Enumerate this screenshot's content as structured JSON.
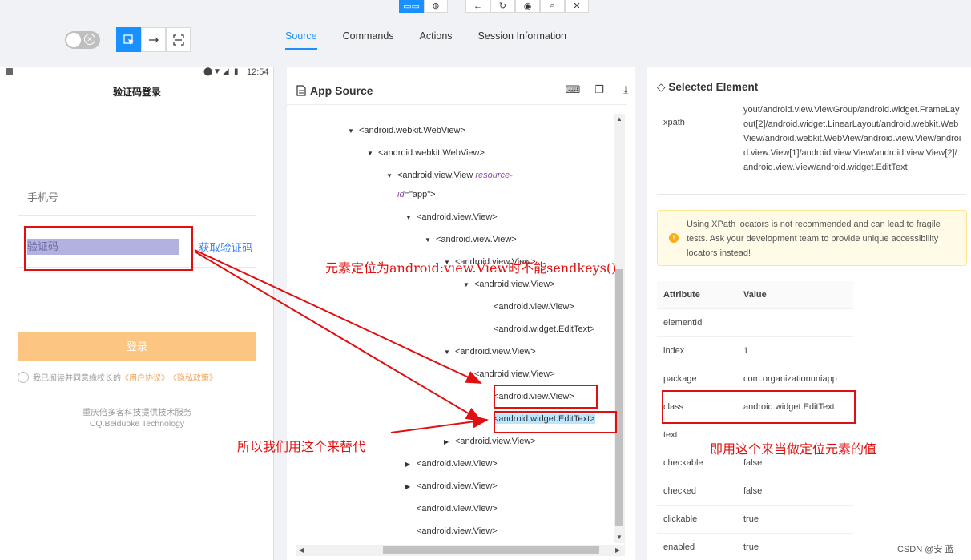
{
  "toolbar": {
    "top_buttons": [
      "▭▭",
      "⊕",
      "←",
      "↻",
      "◉",
      "⌕",
      "✕"
    ],
    "tabs": [
      {
        "label": "Source",
        "active": true
      },
      {
        "label": "Commands",
        "active": false
      },
      {
        "label": "Actions",
        "active": false
      },
      {
        "label": "Session Information",
        "active": false
      }
    ]
  },
  "phone": {
    "time": "12:54",
    "title": "验证码登录",
    "phone_placeholder": "手机号",
    "code_placeholder": "验证码",
    "get_code": "获取验证码",
    "login": "登录",
    "agree_text": "我已阅读并同意缘校长的",
    "agree_link1": "《用户协议》",
    "agree_link2": "《隐私政策》",
    "company_line1": "重庆倍多客科技提供技术服务",
    "company_line2": "CQ.Beiduoke Technology"
  },
  "source": {
    "title": "App Source",
    "icons": [
      "terminal-icon",
      "copy-icon",
      "download-icon"
    ],
    "nodes": [
      {
        "indent": 0,
        "arrow": "▼",
        "tag": "<android.webkit.WebView>"
      },
      {
        "indent": 1,
        "arrow": "▼",
        "tag": "<android.webkit.WebView>"
      },
      {
        "indent": 2,
        "arrow": "▼",
        "tag": "<android.view.View ",
        "attr": "resource-",
        "tag2": "id",
        "tag3": "=\"app\">"
      },
      {
        "indent": 3,
        "arrow": "▼",
        "tag": "<android.view.View>"
      },
      {
        "indent": 4,
        "arrow": "▼",
        "tag": "<android.view.View>"
      },
      {
        "indent": 5,
        "arrow": "▼",
        "tag": "<android.view.View>"
      },
      {
        "indent": 6,
        "arrow": "▼",
        "tag": "<android.view.View>"
      },
      {
        "indent": 7,
        "arrow": "",
        "tag": "<android.view.View>"
      },
      {
        "indent": 7,
        "arrow": "",
        "tag": "<android.widget.EditText>"
      },
      {
        "indent": 5,
        "arrow": "▼",
        "tag": "<android.view.View>"
      },
      {
        "indent": 6,
        "arrow": "",
        "tag": "<android.view.View>"
      },
      {
        "indent": 7,
        "arrow": "",
        "tag": "<android.view.View>"
      },
      {
        "indent": 7,
        "arrow": "",
        "tag": "<android.widget.EditText>",
        "selected": true
      },
      {
        "indent": 5,
        "arrow": "▶",
        "tag": "<android.view.View>"
      },
      {
        "indent": 3,
        "arrow": "▶",
        "tag": "<android.view.View>"
      },
      {
        "indent": 3,
        "arrow": "▶",
        "tag": "<android.view.View>"
      },
      {
        "indent": 3,
        "arrow": "",
        "tag": "<android.view.View>"
      },
      {
        "indent": 3,
        "arrow": "",
        "tag": "<android.view.View>"
      }
    ]
  },
  "selected": {
    "title": "Selected Element",
    "xpath_key": "xpath",
    "xpath_value": "yout/android.view.ViewGroup/android.widget.FrameLayout[2]/android.widget.LinearLayout/android.webkit.WebView/android.webkit.WebView/android.view.View/android.view.View[1]/android.view.View/android.view.View[2]/android.view.View/android.widget.EditText",
    "warning": "Using XPath locators is not recommended and can lead to fragile tests. Ask your development team to provide unique accessibility locators instead!",
    "table_header": {
      "k": "Attribute",
      "v": "Value"
    },
    "attributes": [
      {
        "k": "elementId",
        "v": ""
      },
      {
        "k": "index",
        "v": "1"
      },
      {
        "k": "package",
        "v": "com.organizationuniapp"
      },
      {
        "k": "class",
        "v": "android.widget.EditText"
      },
      {
        "k": "text",
        "v": ""
      },
      {
        "k": "checkable",
        "v": "false"
      },
      {
        "k": "checked",
        "v": "false"
      },
      {
        "k": "clickable",
        "v": "true"
      },
      {
        "k": "enabled",
        "v": "true"
      }
    ]
  },
  "annotations": {
    "note1": "元素定位为android:view.View时不能sendkeys()",
    "note2": "所以我们用这个来替代",
    "note3": "即用这个来当做定位元素的值"
  },
  "watermark": "CSDN @安 蓝"
}
